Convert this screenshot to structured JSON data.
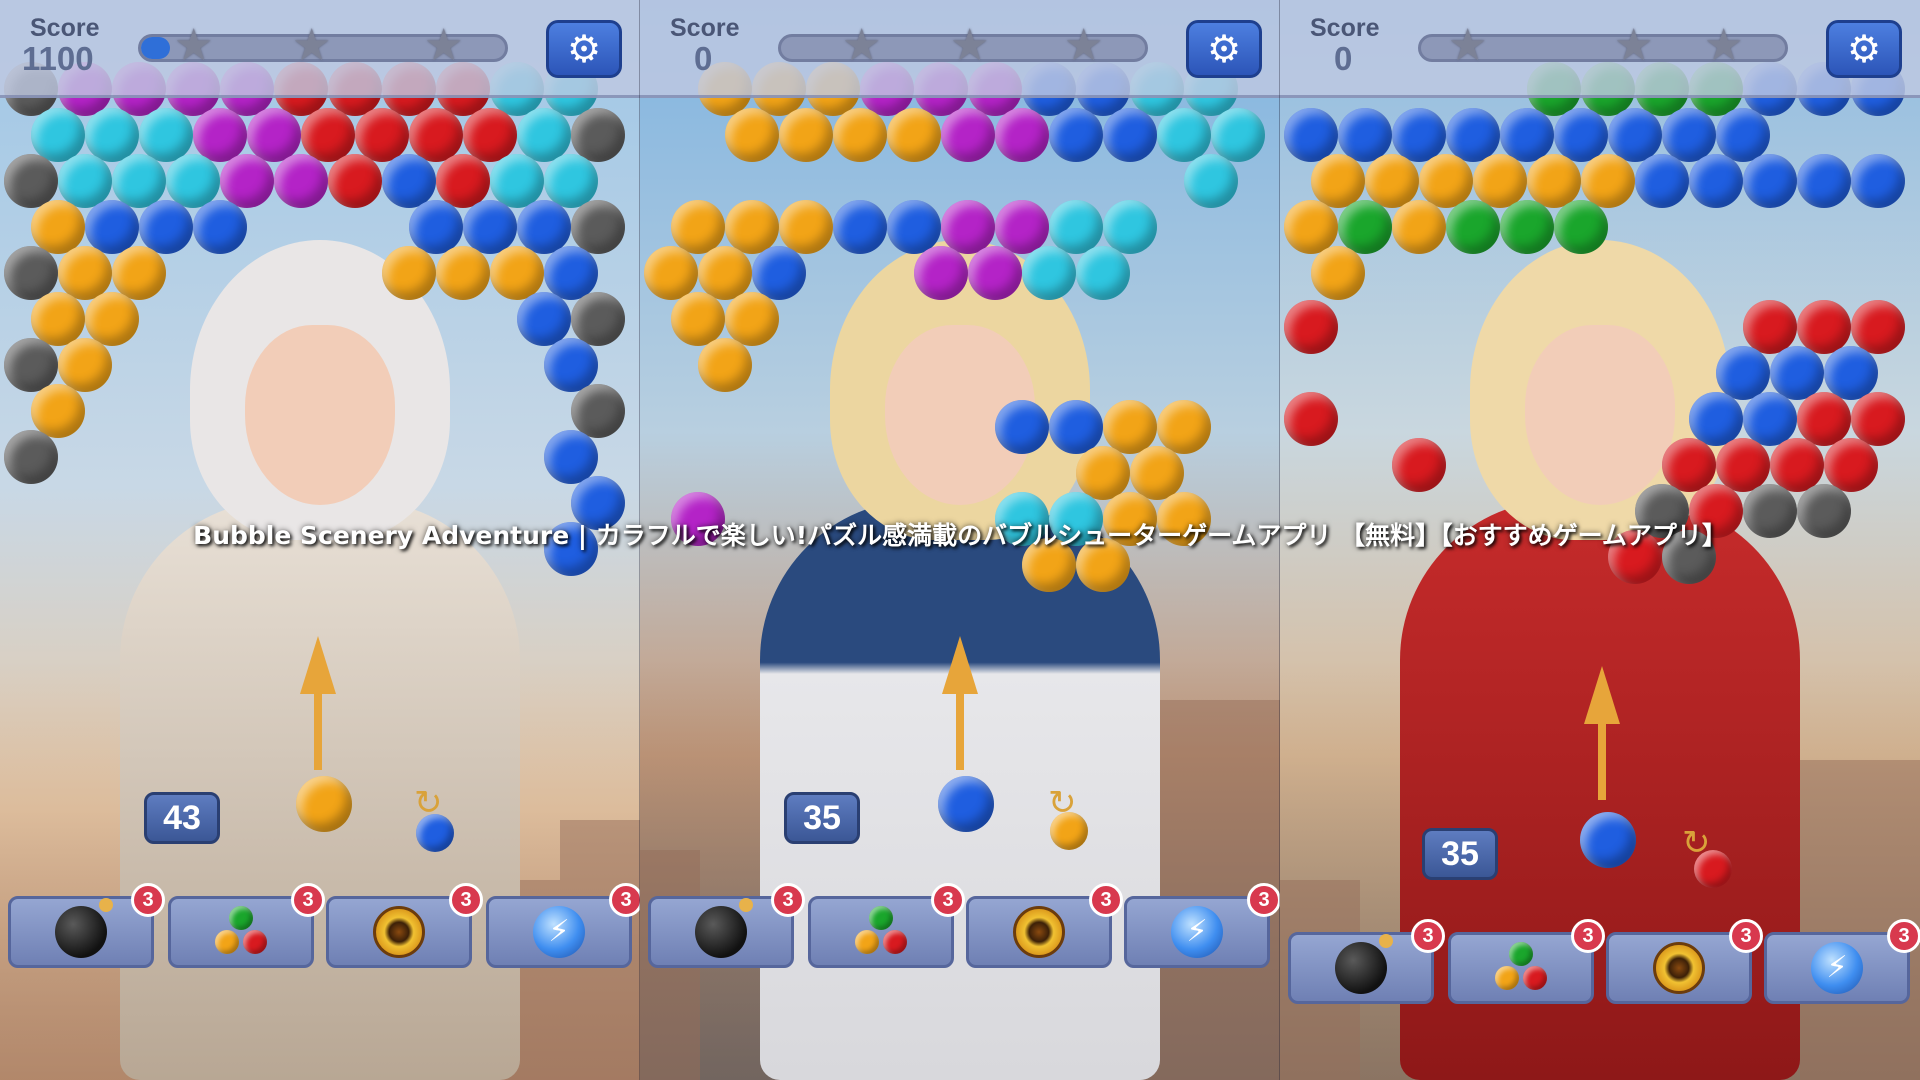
{
  "title": "Bubble Scenery Adventure | カラフルで楽しい!パズル感満載のバブルシューターゲームアプリ 【無料】【おすすめゲームアプリ】",
  "colors": {
    "orange": "#f2a417",
    "cyan": "#2fc6e0",
    "magenta": "#b423c7",
    "red": "#d81a1f",
    "blue": "#1f5ee0",
    "gray": "#5b5b5b",
    "green": "#1aa62c"
  },
  "panels": [
    {
      "score_label": "Score",
      "score": "1100",
      "progress": 0.06,
      "stars_earned": 0,
      "moves": "43",
      "shooter_color": "orange",
      "next_color": "blue",
      "boosters": [
        {
          "icon": "bomb-icon",
          "count": "3"
        },
        {
          "icon": "color-swap-icon",
          "count": "3"
        },
        {
          "icon": "fire-ball-icon",
          "count": "3"
        },
        {
          "icon": "lightning-ball-icon",
          "count": "3"
        }
      ]
    },
    {
      "score_label": "Score",
      "score": "0",
      "progress": 0.0,
      "stars_earned": 0,
      "moves": "35",
      "shooter_color": "blue",
      "next_color": "orange",
      "boosters": [
        {
          "icon": "bomb-icon",
          "count": "3"
        },
        {
          "icon": "color-swap-icon",
          "count": "3"
        },
        {
          "icon": "fire-ball-icon",
          "count": "3"
        },
        {
          "icon": "lightning-ball-icon",
          "count": "3"
        }
      ]
    },
    {
      "score_label": "Score",
      "score": "0",
      "progress": 0.0,
      "stars_earned": 0,
      "moves": "35",
      "shooter_color": "blue",
      "next_color": "red",
      "boosters": [
        {
          "icon": "bomb-icon",
          "count": "3"
        },
        {
          "icon": "color-swap-icon",
          "count": "3"
        },
        {
          "icon": "fire-ball-icon",
          "count": "3"
        },
        {
          "icon": "lightning-ball-icon",
          "count": "3"
        }
      ]
    }
  ]
}
